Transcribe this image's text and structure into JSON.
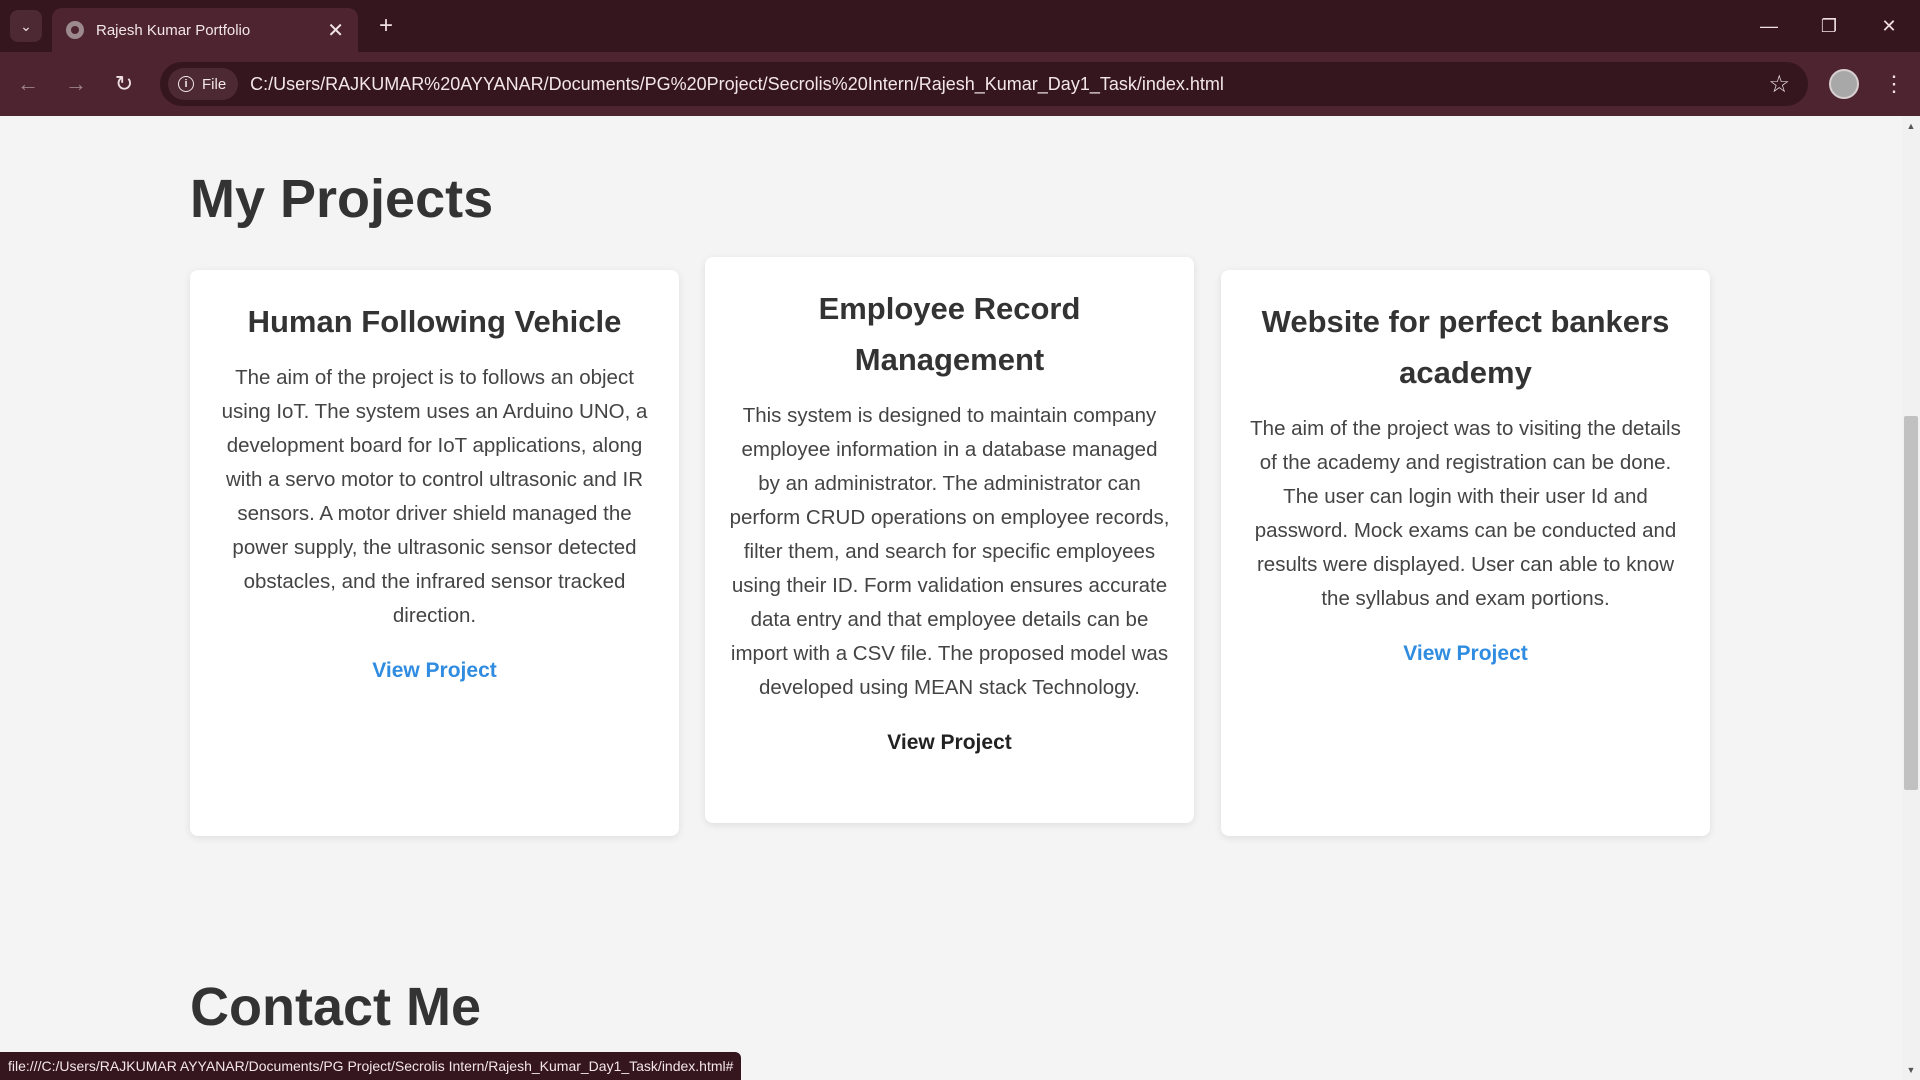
{
  "browser": {
    "tab_title": "Rajesh Kumar Portfolio",
    "site_chip": "File",
    "url": "C:/Users/RAJKUMAR%20AYYANAR/Documents/PG%20Project/Secrolis%20Intern/Rajesh_Kumar_Day1_Task/index.html",
    "status_url": "file:///C:/Users/RAJKUMAR AYYANAR/Documents/PG Project/Secrolis Intern/Rajesh_Kumar_Day1_Task/index.html#"
  },
  "projects": {
    "heading": "My Projects",
    "cards": [
      {
        "title": "Human Following Vehicle",
        "description": "The aim of the project is to follows an object using IoT. The system uses an Arduino UNO, a development board for IoT applications, along with a servo motor to control ultrasonic and IR sensors. A motor driver shield managed the power supply, the ultrasonic sensor detected obstacles, and the infrared sensor tracked direction.",
        "link": "View Project"
      },
      {
        "title": "Employee Record Management",
        "description": "This system is designed to maintain company employee information in a database managed by an administrator. The administrator can perform CRUD operations on employee records, filter them, and search for specific employees using their ID. Form validation ensures accurate data entry and that employee details can be import with a CSV file. The proposed model was developed using MEAN stack Technology.",
        "link": "View Project"
      },
      {
        "title": "Website for perfect bankers academy",
        "description": "The aim of the project was to visiting the details of the academy and registration can be done. The user can login with their user Id and password. Mock exams can be conducted and results were displayed. User can able to know the syllabus and exam portions.",
        "link": "View Project"
      }
    ]
  },
  "contact": {
    "heading": "Contact Me"
  }
}
